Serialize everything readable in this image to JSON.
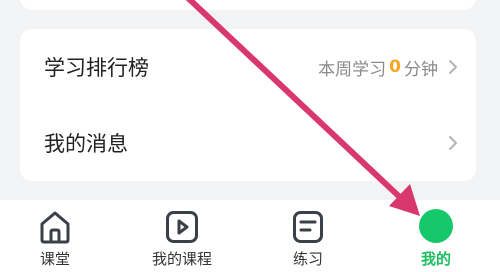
{
  "menu": {
    "ranking": {
      "label": "学习排行榜",
      "summary_prefix": "本周学习",
      "minutes": "0",
      "summary_suffix": "分钟"
    },
    "messages": {
      "label": "我的消息"
    }
  },
  "tabbar": {
    "tabs": [
      {
        "label": "课堂",
        "icon": "home-icon"
      },
      {
        "label": "我的课程",
        "icon": "play-icon"
      },
      {
        "label": "练习",
        "icon": "document-icon"
      },
      {
        "label": "我的",
        "icon": "profile-icon",
        "active": true
      }
    ]
  },
  "colors": {
    "accent": "#1dbf60",
    "highlight": "#f5a623",
    "arrow": "#d9386f"
  }
}
